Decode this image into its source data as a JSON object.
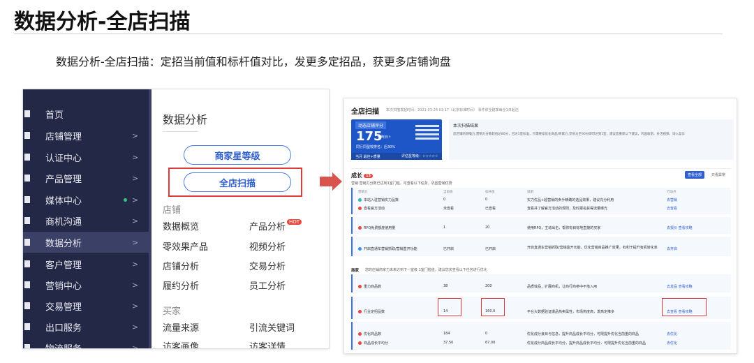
{
  "heading": "数据分析-全店扫描",
  "subtitle": "数据分析-全店扫描：定招当前值和标杆值对比，发更多定招品，获更多店铺询盘",
  "sidebar": {
    "items": [
      {
        "label": "首页",
        "arrow": ""
      },
      {
        "label": "店铺管理",
        "arrow": ">"
      },
      {
        "label": "认证中心",
        "arrow": ">"
      },
      {
        "label": "产品管理",
        "arrow": ">"
      },
      {
        "label": "媒体中心",
        "arrow": ">"
      },
      {
        "label": "商机沟通",
        "arrow": ">"
      },
      {
        "label": "数据分析",
        "arrow": ">"
      },
      {
        "label": "客户管理",
        "arrow": ">"
      },
      {
        "label": "营销中心",
        "arrow": ">"
      },
      {
        "label": "交易管理",
        "arrow": ">"
      },
      {
        "label": "出口服务",
        "arrow": ">"
      },
      {
        "label": "物流服务",
        "arrow": ">"
      }
    ]
  },
  "content": {
    "title": "数据分析",
    "btn_star": "商家星等级",
    "btn_scan": "全店扫描",
    "group_store": "店铺",
    "group_buyer": "买家",
    "links": [
      "数据概览",
      "产品分析",
      "零效果产品",
      "视频分析",
      "店铺分析",
      "交易分析",
      "履约分析",
      "员工分析"
    ],
    "hot": "HOT",
    "buyer_links": [
      "流量来源",
      "引流关键词",
      "访客画像",
      "访客详情"
    ]
  },
  "right": {
    "title": "全店扫描",
    "meta": "本次扫描发起时间：2021-03-24 03:17（北京标准时间） 事件依全建季每全1日起还",
    "score_head": "动态店铺评分",
    "score": "175",
    "score_tag": "较昨日↑",
    "score_rank": "同行同型较排名：后30%",
    "score_foot": "当月 最佳+质量",
    "score_foot2": "评估星等级：☆☆☆☆☆",
    "result_head": "本次扫描结果",
    "result_text": "您店铺的领嗓力,营销力分数较低达80分，已达1室标准，只需继续优化商品/商家力,交易力至90分即可达到1室，建议您重新以下建议，巩固收割、补活视频、询入盈诊",
    "grow": "成长",
    "grow_badge": "15",
    "btn_all": "查看全部",
    "btn_expand": "只看异常",
    "sub": "营销  营销力分数已达到1室门槛，可查看以下任务，巩固营销优势",
    "sec_product": "商家",
    "sec_product_sub": "您的店铺商家力未来达到下一室级 1室门槛值，建议您关查看以下任务进行优化",
    "rows": [
      {
        "name": "本站入驻营销实力品数",
        "cur": "0",
        "bench": "0",
        "desc": "实力优品+超营销的卖手精确的选品效果，建议充分利用",
        "act": "去营销"
      },
      {
        "name": "查看官方活动",
        "cur": "未查看",
        "bench": "已查看",
        "desc": "查看并了解官方活动的规则，及时报名获得流量曝光",
        "act": "去查看"
      },
      {
        "name": "RFQ免费额度使用量",
        "cur": "1",
        "bench": "20",
        "desc": "使用RFQ，主动出击，帮你有目标地直接的买家",
        "act": "去报价 查看攻略"
      },
      {
        "name": "开启直通车营销抓取/营销盒开功能",
        "cur": "已开启",
        "bench": "已开启",
        "desc": "开启直通车营销抓取/营销盒开功能，优化营销商品推广效果，有利于提升有机转化率",
        "act": "去开启"
      },
      {
        "name": "重力商品数",
        "cur": "38",
        "bench": "200",
        "desc": "品质效品，扩展商机，让商行商参中不落入用",
        "act": "去发品 查看攻略"
      },
      {
        "name": "行业定招品数",
        "cur": "14",
        "bench": "160.0",
        "desc": "平台大数据验证爆品热卖属性，市场热度高，发高定推多",
        "act": "去查看 查看攻略"
      },
      {
        "name": "优化商品数",
        "cur": "184",
        "bench": "0",
        "desc": "优化成分良目与信息，提升商品成长平均分，可限提升优化当前重的商品",
        "act": "去优化"
      },
      {
        "name": "商品成长平均分",
        "cur": "37.50",
        "bench": "67.00",
        "desc": "优化成分商品成长平均分，提升商品成长平均分，可限提升优化当前重的商品",
        "act": "去优化"
      }
    ],
    "col_cur": "当前值",
    "col_bench": "标杆值",
    "col_desc": "说明",
    "col_act": "行动点"
  }
}
